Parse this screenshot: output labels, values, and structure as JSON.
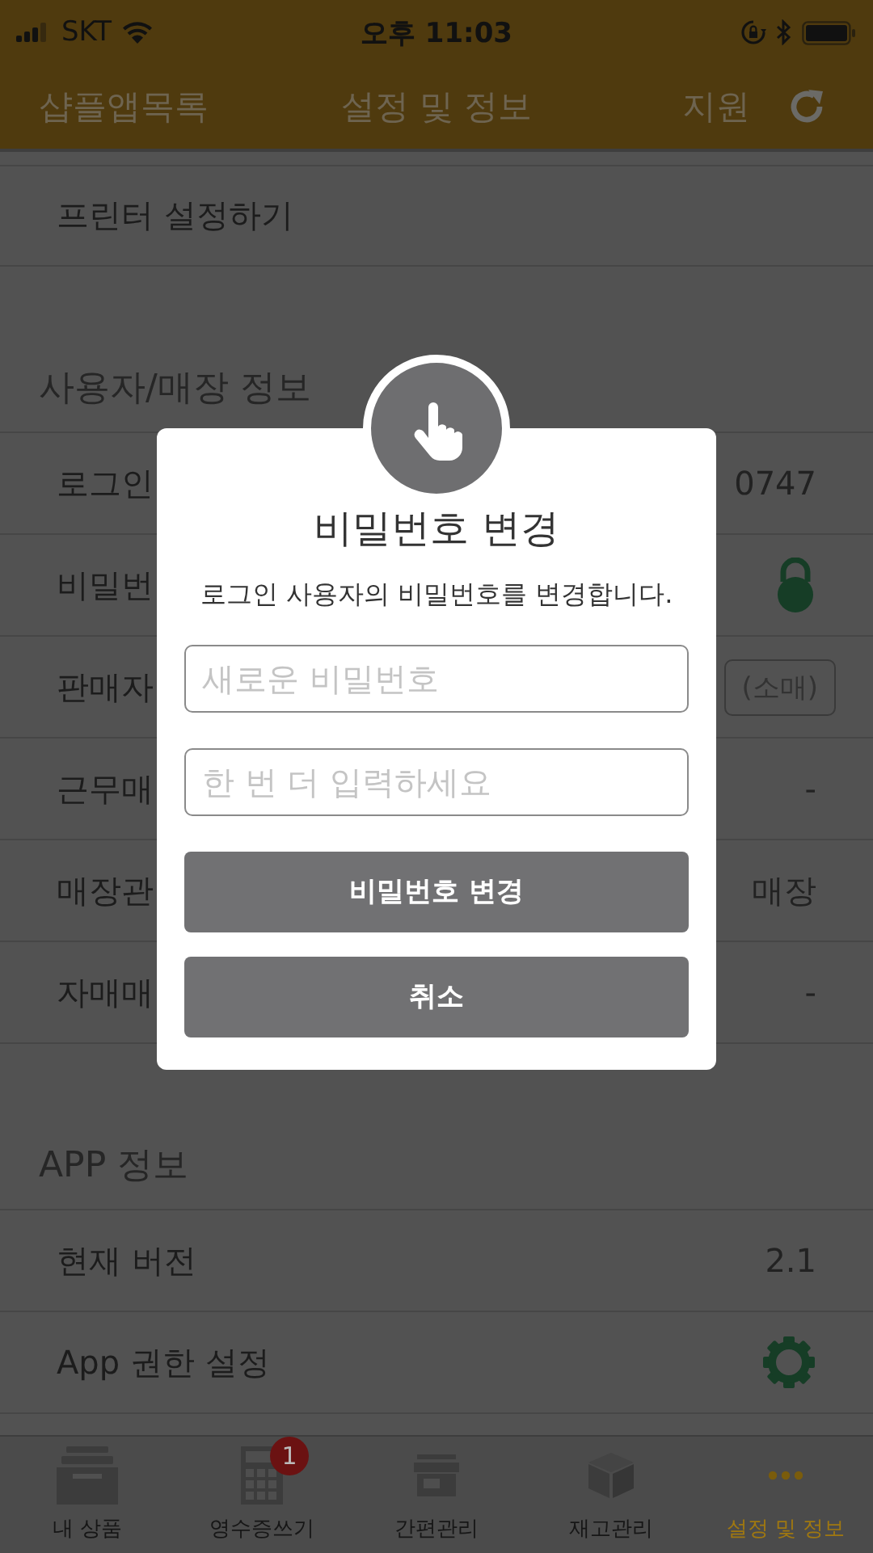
{
  "status_bar": {
    "carrier": "SKT",
    "time": "오후 11:03"
  },
  "header": {
    "left": "샵플앱목록",
    "title": "설정 및 정보",
    "right": "지원"
  },
  "top_rows": [
    {
      "label": "프린터 설정하기"
    }
  ],
  "sections": [
    {
      "title": "사용자/매장 정보",
      "rows": [
        {
          "label": "로그인",
          "kind": "text",
          "value": "0747"
        },
        {
          "label": "비밀번",
          "kind": "lock"
        },
        {
          "label": "판매자",
          "kind": "button",
          "value": "(소매)"
        },
        {
          "label": "근무매",
          "kind": "text",
          "value": "-"
        },
        {
          "label": "매장관",
          "kind": "text",
          "value": "매장"
        },
        {
          "label": "자매매",
          "kind": "text",
          "value": "-"
        }
      ]
    },
    {
      "title": "APP 정보",
      "rows": [
        {
          "label": "현재 버전",
          "kind": "text",
          "value": "2.1"
        },
        {
          "label": "App 권한 설정",
          "kind": "gear"
        }
      ]
    }
  ],
  "dialog": {
    "title": "비밀번호 변경",
    "message": "로그인 사용자의 비밀번호를 변경합니다.",
    "fields": [
      {
        "placeholder": "새로운 비밀번호"
      },
      {
        "placeholder": "한 번 더 입력하세요"
      }
    ],
    "buttons": [
      "비밀번호 변경",
      "취소"
    ]
  },
  "tabs": [
    {
      "label": "내 상품",
      "selected": false
    },
    {
      "label": "영수증쓰기",
      "selected": false,
      "badge": "1"
    },
    {
      "label": "간편관리",
      "selected": false
    },
    {
      "label": "재고관리",
      "selected": false
    },
    {
      "label": "설정 및 정보",
      "selected": true
    }
  ]
}
